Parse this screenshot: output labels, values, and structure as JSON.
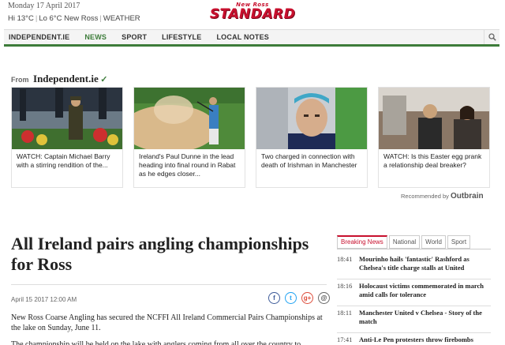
{
  "header": {
    "date": "Monday 17 April 2017",
    "weather": {
      "hi": "Hi 13°C",
      "lo": "Lo 6°C",
      "location": "New Ross",
      "label": "WEATHER"
    },
    "logo": {
      "small": "New Ross",
      "big": "STANDARD"
    }
  },
  "nav": {
    "items": [
      {
        "label": "INDEPENDENT.IE"
      },
      {
        "label": "NEWS"
      },
      {
        "label": "SPORT"
      },
      {
        "label": "LIFESTYLE"
      },
      {
        "label": "LOCAL NOTES"
      }
    ],
    "active_index": 1
  },
  "partner": {
    "from_label": "From",
    "brand": "Independent.ie",
    "cards": [
      {
        "caption": "WATCH: Captain Michael Barry with a stirring rendition of the..."
      },
      {
        "caption": "Ireland's Paul Dunne in the lead heading into final round in Rabat as he edges closer..."
      },
      {
        "caption": "Two charged in connection with death of Irishman in Manchester"
      },
      {
        "caption": "WATCH: Is this Easter egg prank a relationship deal breaker?"
      }
    ],
    "recommended_label": "Recommended by",
    "recommended_brand": "Outbrain"
  },
  "article": {
    "headline": "All Ireland pairs angling championships for Ross",
    "date": "April 15 2017 12:00 AM",
    "body1": "New Ross Coarse Angling has secured the NCFFI All Ireland Commercial Pairs Championships at the lake on Sunday, June 11.",
    "body2": "The championship will be held on the lake with anglers coming from all over the country to compete"
  },
  "share": {
    "facebook": "f",
    "twitter": "t",
    "google": "g+",
    "email": "@"
  },
  "sidebar": {
    "tabs": [
      "Breaking News",
      "National",
      "World",
      "Sport"
    ],
    "active_tab": 0,
    "items": [
      {
        "time": "18:41",
        "title": "Mourinho hails 'fantastic' Rashford as Chelsea's title charge stalls at United"
      },
      {
        "time": "18:16",
        "title": "Holocaust victims commemorated in march amid calls for tolerance"
      },
      {
        "time": "18:11",
        "title": "Manchester United v Chelsea - Story of the match"
      },
      {
        "time": "17:41",
        "title": "Anti-Le Pen protesters throw firebombs"
      }
    ]
  },
  "colors": {
    "brand_red": "#c8102e",
    "nav_green": "#3d7c3a"
  }
}
